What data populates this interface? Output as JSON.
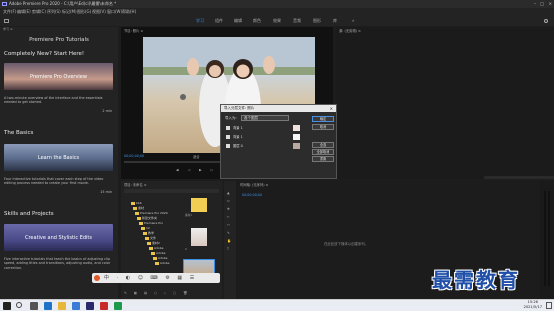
{
  "window": {
    "title": "Adobe Premiere Pro 2020 - C:\\用户\\Ed(ci)\\最需\\未命名 *"
  },
  "menu": [
    "文件(F)",
    "编辑(E)",
    "剪辑(C)",
    "序列(S)",
    "标记(M)",
    "图形(G)",
    "视图(V)",
    "窗口(W)",
    "帮助(H)"
  ],
  "workspaces": [
    "学习",
    "组件",
    "编辑",
    "颜色",
    "效果",
    "音频",
    "图形",
    "库"
  ],
  "learn": {
    "header": "Premiere Pro Tutorials",
    "sections": [
      {
        "title": "Completely New? Start Here!",
        "card": "Premiere Pro Overview",
        "desc": "A two-minute overview of the interface and the essentials needed to get started.",
        "dur": "2 min"
      },
      {
        "title": "The Basics",
        "card": "Learn the Basics",
        "desc": "Four interactive tutorials that cover each step of the video editing process needed to create your first movie.",
        "dur": "15 min"
      },
      {
        "title": "Skills and Projects",
        "card": "Creative and Stylistic Edits",
        "desc": "Five interactive tutorials that teach the basics of adjusting clip speed, adding titles and transitions, adjusting audio, and color correction.",
        "dur": ""
      }
    ]
  },
  "program": {
    "timecode_left": "00;00;00;00",
    "timecode_right": "00;00;00;00",
    "fit": "适合"
  },
  "dialog": {
    "title": "导入分层文件: 照片",
    "import_as_label": "导入为:",
    "import_as_value": "各个图层",
    "layers": [
      "背景 1",
      "背景 1",
      "图层 0"
    ],
    "buttons": [
      "确定",
      "取消",
      "全选",
      "全部取消",
      "重置"
    ]
  },
  "timeline": {
    "timecode": "00;00;00;00",
    "empty_msg": "在此处放下媒体以创建序列。"
  },
  "project": {
    "folders": [
      "bbb",
      "素材",
      "Premiere Pro 2020",
      "新建文件夹",
      "Premiere Pro",
      "12",
      "教学",
      "文件",
      "素材2",
      "Adobe",
      "Adobe",
      "Adobe",
      "Adobe"
    ],
    "thumbs": [
      "素材1",
      "4",
      "5"
    ],
    "thumb_label": "照片"
  },
  "taskbar": {
    "time": "15:26",
    "date": "2021/5/17"
  },
  "watermark": "最需教育"
}
